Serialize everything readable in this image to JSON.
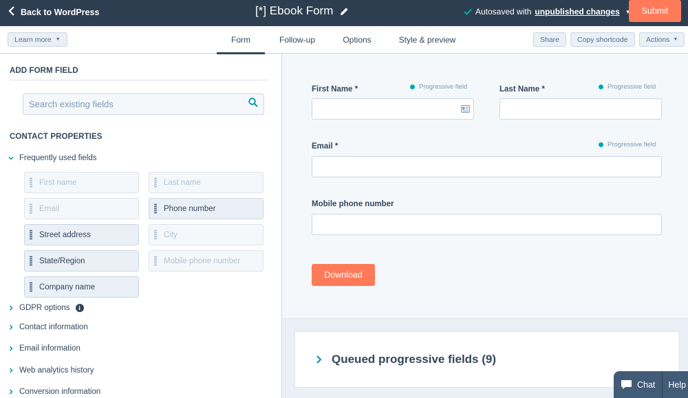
{
  "header": {
    "back_label": "Back to WordPress",
    "title": "[*] Ebook Form",
    "autosave_prefix": "Autosaved with",
    "autosave_link": "unpublished changes",
    "submit_label": "Submit"
  },
  "subnav": {
    "learn_more": "Learn more",
    "tabs": [
      {
        "label": "Form",
        "active": true
      },
      {
        "label": "Follow-up",
        "active": false
      },
      {
        "label": "Options",
        "active": false
      },
      {
        "label": "Style & preview",
        "active": false
      }
    ],
    "share": "Share",
    "copy_shortcode": "Copy shortcode",
    "actions": "Actions"
  },
  "left": {
    "heading": "ADD FORM FIELD",
    "search_placeholder": "Search existing fields",
    "contact_heading": "CONTACT PROPERTIES",
    "frequent_label": "Frequently used fields",
    "fields": [
      {
        "label": "First name",
        "enabled": false
      },
      {
        "label": "Last name",
        "enabled": false
      },
      {
        "label": "Email",
        "enabled": false
      },
      {
        "label": "Phone number",
        "enabled": true
      },
      {
        "label": "Street address",
        "enabled": true
      },
      {
        "label": "City",
        "enabled": false
      },
      {
        "label": "State/Region",
        "enabled": true
      },
      {
        "label": "Mobile phone number",
        "enabled": false
      },
      {
        "label": "Company name",
        "enabled": true
      }
    ],
    "groups": [
      "GDPR options",
      "Contact information",
      "Email information",
      "Web analytics history",
      "Conversion information"
    ]
  },
  "form": {
    "first_name": "First Name *",
    "last_name": "Last Name *",
    "email": "Email *",
    "mobile": "Mobile phone number",
    "progressive": "Progressive field",
    "download": "Download",
    "queued": "Queued progressive fields (9)"
  },
  "chat": {
    "chat_label": "Chat",
    "help_label": "Help"
  },
  "colors": {
    "topbar": "#2d3e50",
    "accent": "#ff7a59",
    "teal": "#00a4bd"
  }
}
